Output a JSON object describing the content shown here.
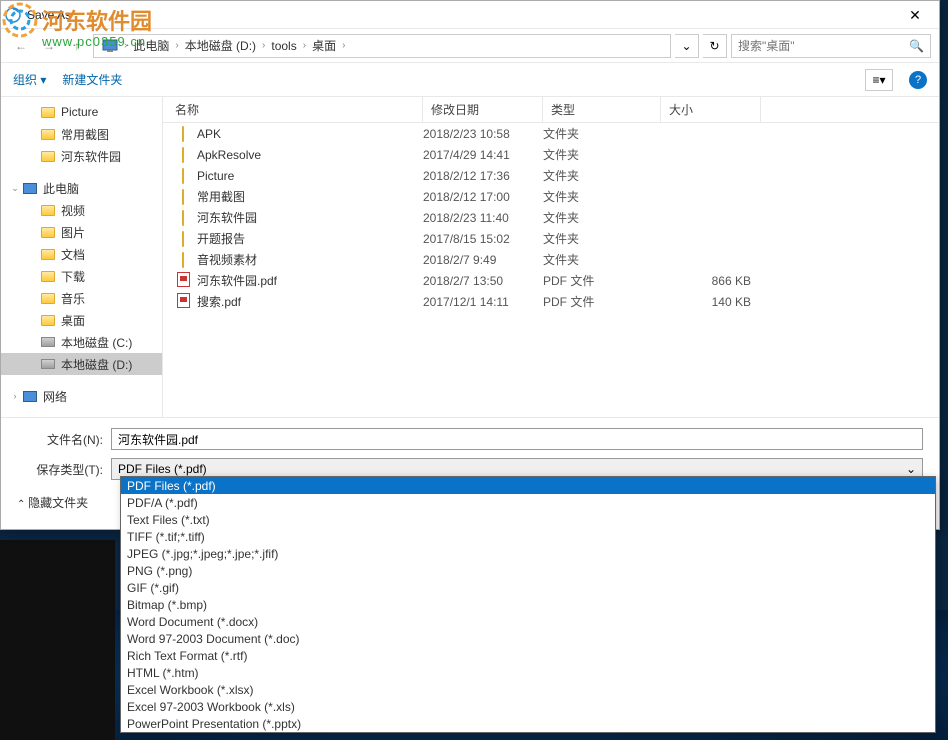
{
  "window": {
    "title": "Save As",
    "close": "✕"
  },
  "nav": {
    "back": "←",
    "fwd": "→",
    "up": "↑"
  },
  "breadcrumb": {
    "items": [
      "此电脑",
      "本地磁盘 (D:)",
      "tools",
      "桌面"
    ],
    "sep": "›"
  },
  "search": {
    "placeholder": "搜索\"桌面\""
  },
  "toolbar": {
    "organize": "组织 ▾",
    "newfolder": "新建文件夹",
    "help": "?"
  },
  "sidebar": {
    "items": [
      {
        "label": "Picture",
        "icon": "folder",
        "lvl": 2
      },
      {
        "label": "常用截图",
        "icon": "folder",
        "lvl": 2
      },
      {
        "label": "河东软件园",
        "icon": "folder",
        "lvl": 2
      },
      {
        "label": "",
        "icon": "",
        "lvl": 2
      },
      {
        "label": "此电脑",
        "icon": "pc",
        "lvl": 1,
        "expand": "⌄"
      },
      {
        "label": "视频",
        "icon": "folder",
        "lvl": 2
      },
      {
        "label": "图片",
        "icon": "folder",
        "lvl": 2
      },
      {
        "label": "文档",
        "icon": "folder",
        "lvl": 2
      },
      {
        "label": "下载",
        "icon": "folder",
        "lvl": 2
      },
      {
        "label": "音乐",
        "icon": "folder",
        "lvl": 2
      },
      {
        "label": "桌面",
        "icon": "folder",
        "lvl": 2
      },
      {
        "label": "本地磁盘 (C:)",
        "icon": "disk",
        "lvl": 2
      },
      {
        "label": "本地磁盘 (D:)",
        "icon": "disk",
        "lvl": 2,
        "selected": true
      },
      {
        "label": "",
        "icon": "",
        "lvl": 2
      },
      {
        "label": "网络",
        "icon": "pc",
        "lvl": 1,
        "expand": "›"
      }
    ]
  },
  "columns": {
    "name": "名称",
    "date": "修改日期",
    "type": "类型",
    "size": "大小"
  },
  "files": [
    {
      "name": "APK",
      "date": "2018/2/23 10:58",
      "type": "文件夹",
      "size": "",
      "icon": "folder"
    },
    {
      "name": "ApkResolve",
      "date": "2017/4/29 14:41",
      "type": "文件夹",
      "size": "",
      "icon": "folder"
    },
    {
      "name": "Picture",
      "date": "2018/2/12 17:36",
      "type": "文件夹",
      "size": "",
      "icon": "folder"
    },
    {
      "name": "常用截图",
      "date": "2018/2/12 17:00",
      "type": "文件夹",
      "size": "",
      "icon": "folder"
    },
    {
      "name": "河东软件园",
      "date": "2018/2/23 11:40",
      "type": "文件夹",
      "size": "",
      "icon": "folder"
    },
    {
      "name": "开题报告",
      "date": "2017/8/15 15:02",
      "type": "文件夹",
      "size": "",
      "icon": "folder"
    },
    {
      "name": "音视频素材",
      "date": "2018/2/7 9:49",
      "type": "文件夹",
      "size": "",
      "icon": "folder"
    },
    {
      "name": "河东软件园.pdf",
      "date": "2018/2/7 13:50",
      "type": "PDF 文件",
      "size": "866 KB",
      "icon": "pdf"
    },
    {
      "name": "搜索.pdf",
      "date": "2017/12/1 14:11",
      "type": "PDF 文件",
      "size": "140 KB",
      "icon": "pdf"
    }
  ],
  "fields": {
    "filename_label": "文件名(N):",
    "filename_value": "河东软件园.pdf",
    "savetype_label": "保存类型(T):",
    "savetype_value": "PDF Files (*.pdf)",
    "hide": "隐藏文件夹"
  },
  "dropdown": {
    "options": [
      "PDF Files (*.pdf)",
      "PDF/A (*.pdf)",
      "Text Files (*.txt)",
      "TIFF (*.tif;*.tiff)",
      "JPEG (*.jpg;*.jpeg;*.jpe;*.jfif)",
      "PNG (*.png)",
      "GIF (*.gif)",
      "Bitmap (*.bmp)",
      "Word Document (*.docx)",
      "Word 97-2003 Document (*.doc)",
      "Rich Text Format (*.rtf)",
      "HTML (*.htm)",
      "Excel Workbook (*.xlsx)",
      "Excel 97-2003 Workbook (*.xls)",
      "PowerPoint Presentation (*.pptx)"
    ],
    "selected": 0
  },
  "watermark": {
    "text": "河东软件园",
    "url": "www.pc0359.cn"
  }
}
